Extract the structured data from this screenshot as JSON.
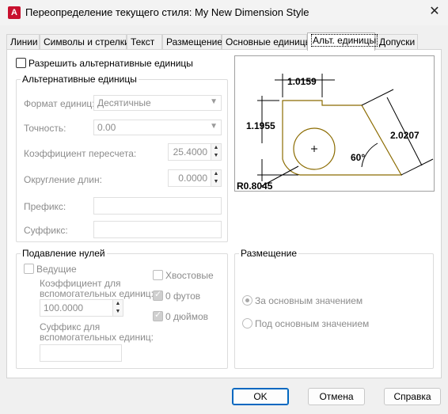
{
  "window": {
    "title": "Переопределение текущего стиля: My New Dimension Style",
    "app_icon_letter": "A",
    "close_glyph": "✕"
  },
  "tabs": [
    {
      "label": "Линии"
    },
    {
      "label": "Символы и стрелки"
    },
    {
      "label": "Текст"
    },
    {
      "label": "Размещение"
    },
    {
      "label": "Основные единицы"
    },
    {
      "label": "Альт. единицы",
      "active": true
    },
    {
      "label": "Допуски"
    }
  ],
  "alt_units": {
    "enable_label": "Разрешить альтернативные единицы",
    "enabled": false,
    "group_title": "Альтернативные единицы",
    "unit_format_label": "Формат единиц:",
    "unit_format_value": "Десятичные",
    "precision_label": "Точность:",
    "precision_value": "0.00",
    "multiplier_label": "Коэффициент пересчета:",
    "multiplier_value": "25.4000",
    "round_label": "Округление длин:",
    "round_value": "0.0000",
    "prefix_label": "Префикс:",
    "prefix_value": "",
    "suffix_label": "Суффикс:",
    "suffix_value": ""
  },
  "zero_suppression": {
    "group_title": "Подавление нулей",
    "leading_label": "Ведущие",
    "leading_checked": false,
    "trailing_label": "Хвостовые",
    "trailing_checked": false,
    "feet_label": "0 футов",
    "feet_checked": true,
    "inches_label": "0 дюймов",
    "inches_checked": true,
    "sub_factor_label_1": "Коэффициент для",
    "sub_factor_label_2": "вспомогательных единиц:",
    "sub_factor_value": "100.0000",
    "sub_suffix_label_1": "Суффикс для",
    "sub_suffix_label_2": "вспомогательных единиц:",
    "sub_suffix_value": ""
  },
  "placement": {
    "group_title": "Размещение",
    "after_label": "За основным значением",
    "after_selected": true,
    "below_label": "Под основным значением",
    "below_selected": false
  },
  "preview": {
    "dim_top": "1.0159",
    "dim_left": "1.1955",
    "dim_diag": "2.0207",
    "angle": "60°",
    "radius": "R0.8045",
    "line_color": "#8b6b00"
  },
  "buttons": {
    "ok": "OK",
    "cancel": "Отмена",
    "help": "Справка"
  }
}
